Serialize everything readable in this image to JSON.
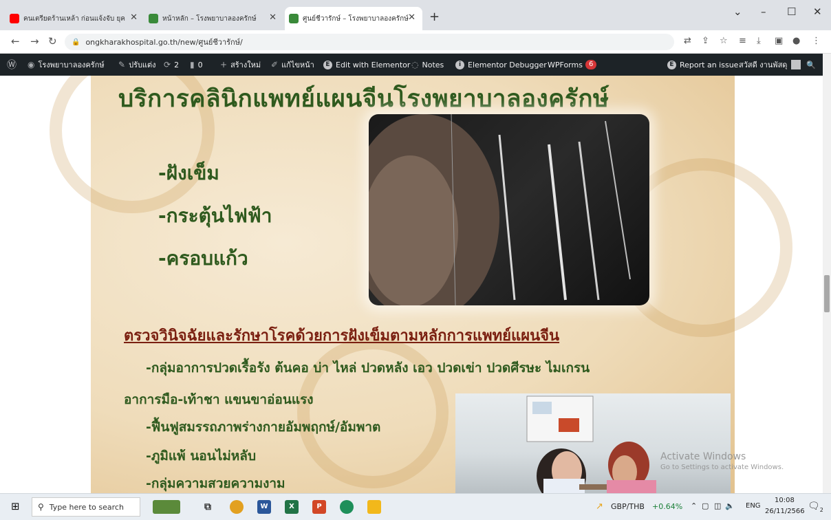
{
  "browser": {
    "tabs": [
      {
        "title": "คนเตรียดร้านเหล้า ก่อนแจ้งจับ ยุค",
        "favicon": "youtube-icon",
        "color": "#ff0000"
      },
      {
        "title": "หน้าหลัก – โรงพยาบาลองครักษ์",
        "favicon": "hospital-logo-icon",
        "color": "#3a8a3a"
      },
      {
        "title": "ศูนย์ชีวารักษ์ – โรงพยาบาลองครักษ์",
        "favicon": "hospital-logo-icon",
        "color": "#3a8a3a"
      }
    ],
    "url": "ongkharakhospital.go.th/new/ศูนย์ชีวารักษ์/"
  },
  "adminbar": {
    "site_name": "โรงพยาบาลองครักษ์",
    "customize": "ปรับแต่ง",
    "updates_count": "2",
    "comments_count": "0",
    "new_label": "สร้างใหม่",
    "edit_page": "แก้ไขหน้า",
    "edit_elementor": "Edit with Elementor",
    "notes": "Notes",
    "debugger": "Elementor Debugger",
    "wpforms": "WPForms",
    "wpforms_badge": "6",
    "report_issue": "Report an issue",
    "greeting": "สวัสดี งานพัสดุ"
  },
  "poster": {
    "headline": "บริการคลินิกแพทย์แผนจีนโรงพยาบาลองครักษ์",
    "services": [
      "-ฝังเข็ม",
      "-กระตุ้นไฟฟ้า",
      "-ครอบแก้ว"
    ],
    "subheading": "ตรวจวินิจฉัยและรักษาโรคด้วยการฝังเข็มตามหลักการแพทย์แผนจีน",
    "indications": [
      "-กลุ่มอาการปวดเรื้อรัง ต้นคอ บ่า ไหล่ ปวดหลัง เอว ปวดเข่า ปวดศีรษะ ไมเกรน",
      "อาการมือ-เท้าชา แขนขาอ่อนแรง",
      "-ฟื้นฟูสมรรถภาพร่างกายอัมพฤกษ์/อัมพาต",
      "-ภูมิแพ้ นอนไม่หลับ",
      "-กลุ่มความสวยความงาม"
    ]
  },
  "watermark": {
    "line1": "Activate Windows",
    "line2": "Go to Settings to activate Windows."
  },
  "taskbar": {
    "search_placeholder": "Type here to search",
    "currency": "GBP/THB",
    "currency_change": "+0.64%",
    "lang": "ENG",
    "time": "10:08",
    "date": "26/11/2566",
    "notif_count": "2"
  }
}
